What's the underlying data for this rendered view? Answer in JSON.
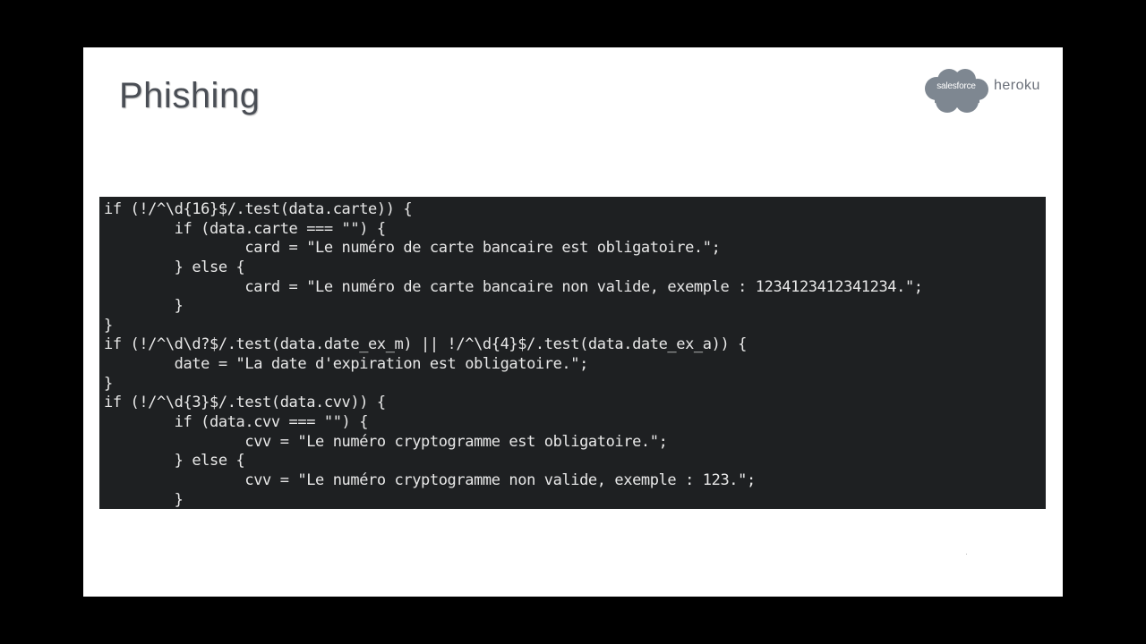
{
  "slide": {
    "title": "Phishing",
    "logo": {
      "primary": "salesforce",
      "secondary": "heroku",
      "cloud_color": "#7e8791"
    },
    "code_lines": [
      "if (!/^\\d{16}$/.test(data.carte)) {",
      "        if (data.carte === \"\") {",
      "                card = \"Le numéro de carte bancaire est obligatoire.\";",
      "        } else {",
      "                card = \"Le numéro de carte bancaire non valide, exemple : 1234123412341234.\";",
      "        }",
      "}",
      "if (!/^\\d\\d?$/.test(data.date_ex_m) || !/^\\d{4}$/.test(data.date_ex_a)) {",
      "        date = \"La date d'expiration est obligatoire.\";",
      "}",
      "if (!/^\\d{3}$/.test(data.cvv)) {",
      "        if (data.cvv === \"\") {",
      "                cvv = \"Le numéro cryptogramme est obligatoire.\";",
      "        } else {",
      "                cvv = \"Le numéro cryptogramme non valide, exemple : 123.\";",
      "        }"
    ]
  }
}
